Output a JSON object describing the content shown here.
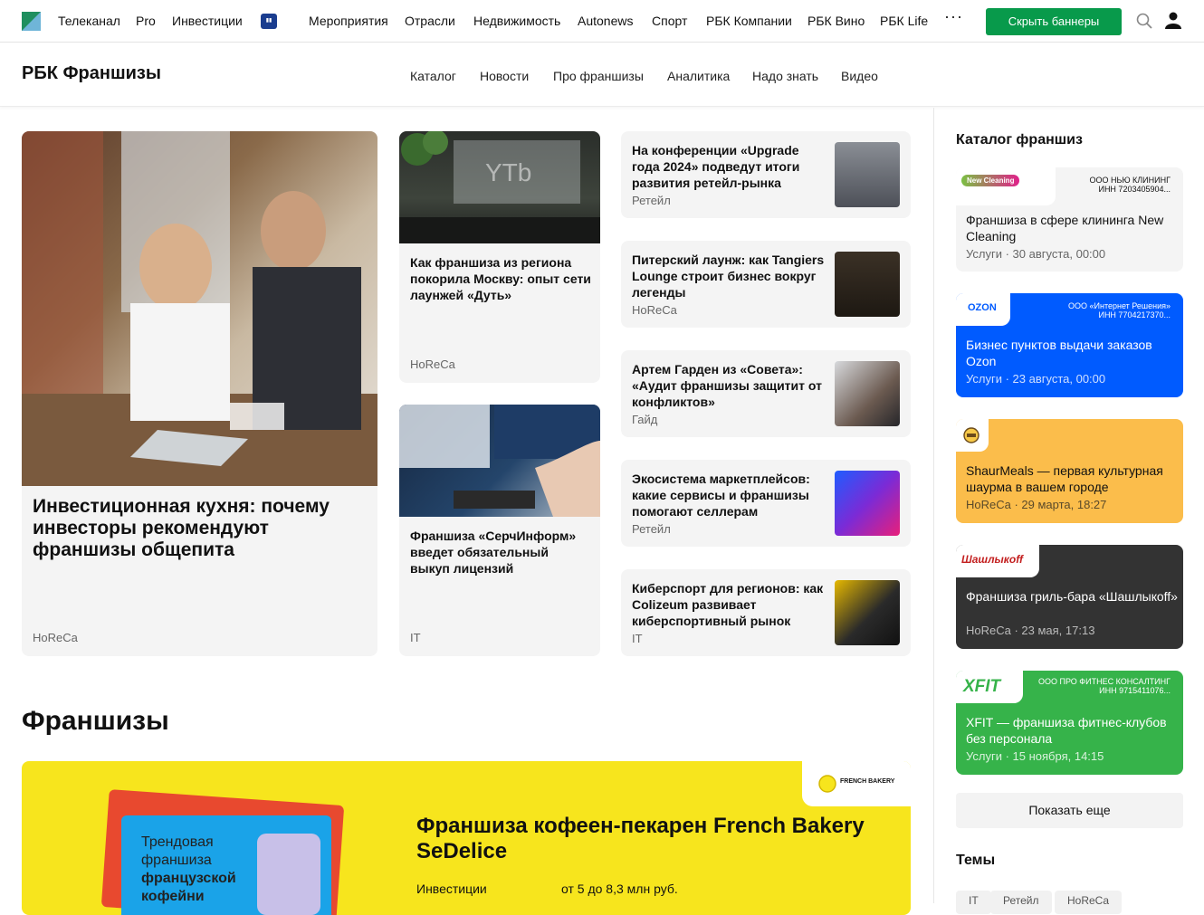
{
  "topbar": {
    "nav": [
      "Телеканал",
      "Pro",
      "Инвестиции",
      "Мероприятия",
      "Отрасли",
      "Недвижимость",
      "Autonews",
      "Спорт",
      "РБК Компании",
      "РБК Вино",
      "РБК Life"
    ],
    "more": "···",
    "hide_banners": "Скрыть баннеры",
    "logo_icon": "rbc-logo-icon",
    "search_icon": "search-icon",
    "user_icon": "user-icon"
  },
  "subbar": {
    "title": "РБК Франшизы",
    "nav": [
      "Каталог",
      "Новости",
      "Про франшизы",
      "Аналитика",
      "Надо знать",
      "Видео"
    ]
  },
  "main": {
    "lead": {
      "title": "Инвестиционная кухня: почему инвесторы рекомендуют франшизы общепита",
      "category": "HoReCa"
    },
    "mid": [
      {
        "title": "Как франшиза из региона покорила Москву: опыт сети лаунжей «Дуть»",
        "category": "HoReCa"
      },
      {
        "title": "Франшиза «СерчИнформ» введет обязательный выкуп лицензий",
        "category": "IT"
      }
    ],
    "list": [
      {
        "title": "На конференции «Upgrade года 2024» подведут итоги развития ретейл-рынка",
        "category": "Ретейл"
      },
      {
        "title": "Питерский лаунж: как Tangiers Lounge строит бизнес вокруг легенды",
        "category": "HoReCa"
      },
      {
        "title": "Артем Гарден из «Совета»: «Аудит франшизы защитит от конфликтов»",
        "category": "Гайд"
      },
      {
        "title": "Экосистема маркетплейсов: какие сервисы и франшизы помогают селлерам",
        "category": "Ретейл"
      },
      {
        "title": "Киберспорт для регионов: как Colizeum развивает киберспортивный рынок",
        "category": "IT"
      }
    ]
  },
  "franchises": {
    "heading": "Франшизы",
    "banner": {
      "logo_text": "FRENCH BAKERY",
      "title": "Франшиза кофеен-пекарен French Bakery SeDelice",
      "row_label": "Инвестиции",
      "row_value": "от 5 до 8,3 млн руб.",
      "promo_lines": [
        "Трендовая",
        "франшиза",
        "французской",
        "кофейни"
      ]
    }
  },
  "sidebar": {
    "heading": "Каталог франшиз",
    "items": [
      {
        "logo": "New Cleaning",
        "legal": "ООО НЬЮ КЛИНИНГ\nИНН 7203405904...",
        "title": "Франшиза в сфере клининга New Cleaning",
        "meta": "Услуги · 30 августа, 00:00",
        "bg": "#f4f4f4",
        "fg": "#111"
      },
      {
        "logo": "OZON",
        "legal": "ООО «Интернет Решения»\nИНН 7704217370...",
        "title": "Бизнес пунктов выдачи заказов Ozon",
        "meta": "Услуги · 23 августа, 00:00",
        "bg": "#005bff",
        "fg": "#ffffff"
      },
      {
        "logo": "ShaurMeals",
        "legal": "",
        "title": "ShaurMeals — первая культурная шаурма в вашем городе",
        "meta": "HoReCa · 29 марта, 18:27",
        "bg": "#fbbd4b",
        "fg": "#111"
      },
      {
        "logo": "Шашлыкoff",
        "legal": "",
        "title": "Франшиза гриль-бара «Шашлыкoff»",
        "meta": "HoReCa · 23 мая, 17:13",
        "bg": "#333333",
        "fg": "#ffffff"
      },
      {
        "logo": "XFIT",
        "legal": "ООО ПРО ФИТНЕС КОНСАЛТИНГ\nИНН 9715411076...",
        "title": "XFIT — франшиза фитнес-клубов без персонала",
        "meta": "Услуги · 15 ноября, 14:15",
        "bg": "#36b34a",
        "fg": "#ffffff"
      }
    ],
    "show_more": "Показать еще",
    "themes_heading": "Темы",
    "tags": [
      "IT",
      "Ретейл",
      "HoReCa"
    ]
  },
  "colors": {
    "accent_green": "#089a4b",
    "banner_yellow": "#f7e51d"
  }
}
